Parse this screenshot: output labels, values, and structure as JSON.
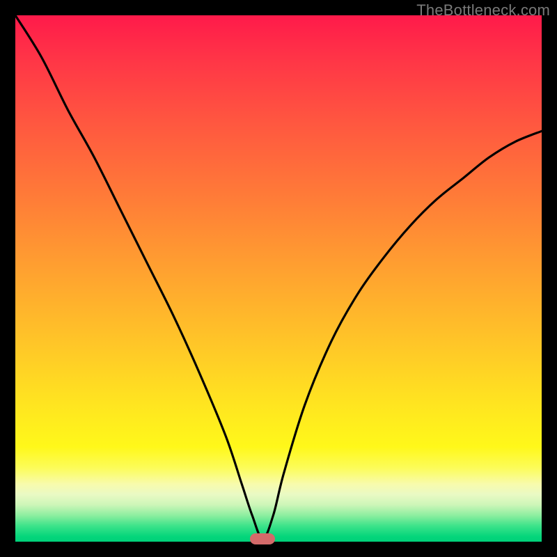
{
  "watermark": "TheBottleneck.com",
  "marker": {
    "rel_x": 0.47,
    "rel_y": 0.995,
    "color": "#d46a6a"
  },
  "chart_data": {
    "type": "line",
    "title": "",
    "xlabel": "",
    "ylabel": "",
    "xlim": [
      0,
      1
    ],
    "ylim": [
      0,
      1
    ],
    "grid": false,
    "legend": false,
    "series": [
      {
        "name": "bottleneck-curve",
        "x": [
          0.0,
          0.05,
          0.1,
          0.15,
          0.2,
          0.25,
          0.3,
          0.35,
          0.4,
          0.43,
          0.45,
          0.47,
          0.49,
          0.51,
          0.55,
          0.6,
          0.65,
          0.7,
          0.75,
          0.8,
          0.85,
          0.9,
          0.95,
          1.0
        ],
        "y": [
          1.0,
          0.92,
          0.82,
          0.73,
          0.63,
          0.53,
          0.43,
          0.32,
          0.2,
          0.11,
          0.05,
          0.005,
          0.05,
          0.13,
          0.26,
          0.38,
          0.47,
          0.54,
          0.6,
          0.65,
          0.69,
          0.73,
          0.76,
          0.78
        ]
      }
    ],
    "annotations": [
      {
        "type": "marker",
        "x": 0.47,
        "y": 0.005,
        "shape": "rounded-rect",
        "color": "#d46a6a"
      }
    ],
    "background_gradient": {
      "direction": "top-to-bottom",
      "stops": [
        {
          "pos": 0.0,
          "color": "#ff1a4a"
        },
        {
          "pos": 0.5,
          "color": "#ffb82c"
        },
        {
          "pos": 0.82,
          "color": "#fff81a"
        },
        {
          "pos": 1.0,
          "color": "#00d07a"
        }
      ]
    }
  }
}
